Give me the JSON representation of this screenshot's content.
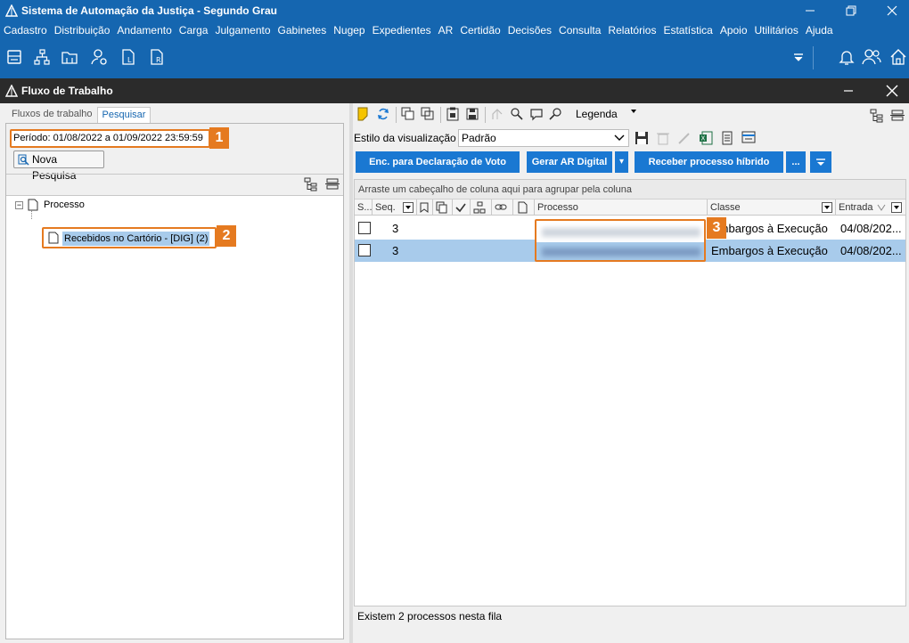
{
  "window": {
    "title": "Sistema de Automação da Justiça - Segundo Grau"
  },
  "menu": [
    "Cadastro",
    "Distribuição",
    "Andamento",
    "Carga",
    "Julgamento",
    "Gabinetes",
    "Nugep",
    "Expedientes",
    "AR",
    "Certidão",
    "Decisões",
    "Consulta",
    "Relatórios",
    "Estatística",
    "Apoio",
    "Utilitários",
    "Ajuda"
  ],
  "toolbar_icons": [
    "printer-icon",
    "org-chart-icon",
    "folder-icon",
    "user-settings-icon",
    "document-l-icon",
    "document-r-icon"
  ],
  "subwindow": {
    "title": "Fluxo de Trabalho"
  },
  "left": {
    "tabs": [
      "Fluxos de trabalho",
      "Pesquisar"
    ],
    "active_tab": "Pesquisar",
    "period": "Período: 01/08/2022 a 01/09/2022 23:59:59",
    "new_search": "Nova Pesquisa",
    "tree": {
      "root": "Processo",
      "child": "Recebidos no Cartório - [DIG] (2)"
    }
  },
  "badges": {
    "b1": "1",
    "b2": "2",
    "b3": "3"
  },
  "right": {
    "legend_label": "Legenda",
    "view_style_label": "Estilo da visualização",
    "view_style_value": "Padrão",
    "actions": {
      "enc": "Enc. para Declaração de Voto",
      "gerar": "Gerar AR Digital",
      "receber": "Receber processo híbrido",
      "more": "...",
      "menu": "▾"
    },
    "grid": {
      "group_hint": "Arraste um cabeçalho de coluna aqui para agrupar pela coluna",
      "headers": {
        "s": "S...",
        "seq": "Seq.",
        "processo": "Processo",
        "classe": "Classe",
        "entrada": "Entrada"
      },
      "rows": [
        {
          "seq": "3",
          "classe": "Embargos à Execução",
          "entrada": "04/08/202..."
        },
        {
          "seq": "3",
          "classe": "Embargos à Execução",
          "entrada": "04/08/202..."
        }
      ]
    },
    "status": "Existem 2 processos nesta fila"
  },
  "colors": {
    "brand": "#1566b0",
    "highlight": "#e57a20",
    "selection": "#a8cbeb",
    "action_button": "#1a78d2"
  }
}
